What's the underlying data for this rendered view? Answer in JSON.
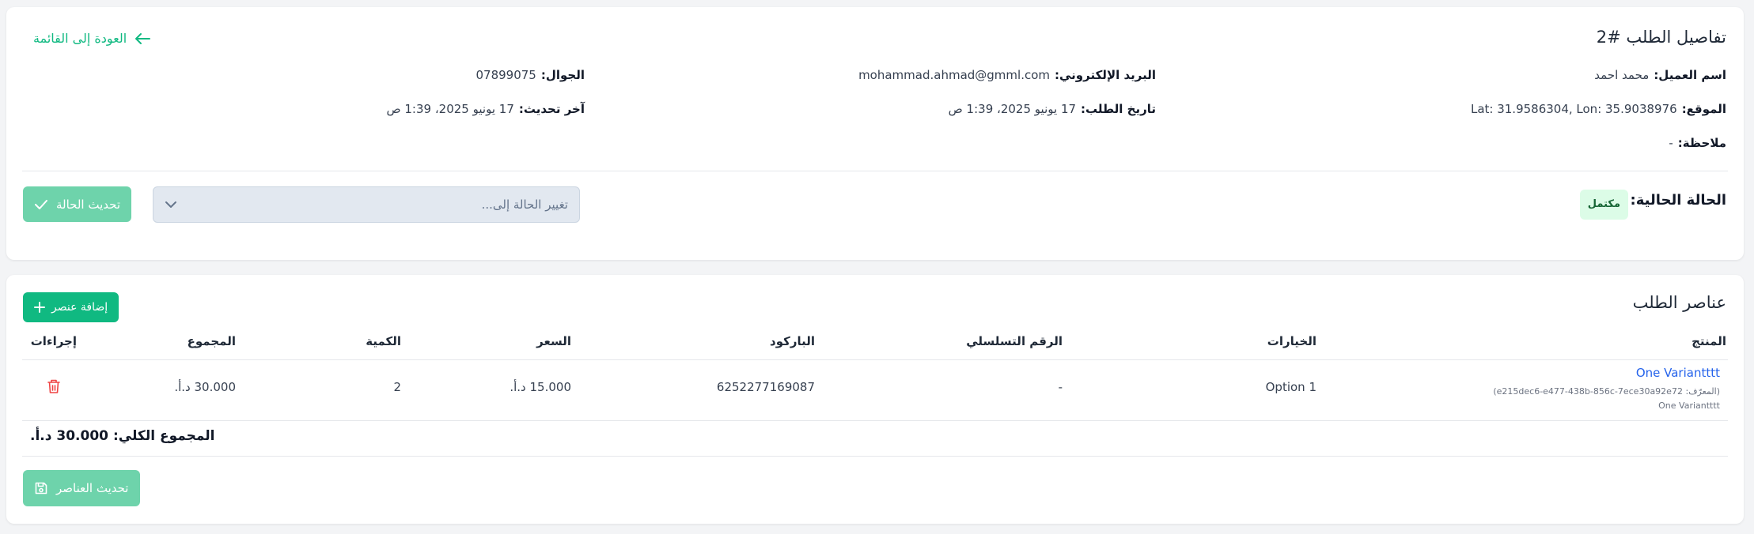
{
  "details": {
    "title": "تفاصيل الطلب #2",
    "back_label": "العودة إلى القائمة",
    "customer_name_label": "اسم العميل:",
    "customer_name": "محمد احمد",
    "email_label": "البريد الإلكتروني:",
    "email": "mohammad.ahmad@gmml.com",
    "phone_label": "الجوال:",
    "phone": "07899075",
    "location_label": "الموقع:",
    "location": "Lat: 31.9586304, Lon: 35.9038976",
    "order_date_label": "تاريخ الطلب:",
    "order_date": "17 يونيو 2025، 1:39 ص",
    "last_update_label": "آخر تحديث:",
    "last_update": "17 يونيو 2025، 1:39 ص",
    "note_label": "ملاحظة:",
    "note": "-",
    "current_status_label": "الحالة الحالية:",
    "current_status": "مكتمل",
    "status_select_placeholder": "تغيير الحالة إلى...",
    "update_status_label": "تحديث الحالة"
  },
  "items": {
    "title": "عناصر الطلب",
    "add_item_label": "إضافة عنصر",
    "columns": {
      "product": "المنتج",
      "options": "الخيارات",
      "serial": "الرقم التسلسلي",
      "barcode": "الباركود",
      "price": "السعر",
      "quantity": "الكمية",
      "total": "المجموع",
      "actions": "إجراءات"
    },
    "rows": [
      {
        "product_name": "One Variantttt",
        "product_id": "(المعرّف: e215dec6-e477-438b-856c-7ece30a92e72)",
        "product_subtitle": "One Variantttt",
        "options": "Option 1",
        "serial": "-",
        "barcode": "6252277169087",
        "price": "15.000 د.أ.",
        "quantity": "2",
        "total": "30.000 د.أ."
      }
    ],
    "grand_total_label": "المجموع الكلي:",
    "grand_total": "30.000 د.أ.",
    "update_items_label": "تحديث العناصر"
  },
  "colors": {
    "accent": "#10b981",
    "accent_light": "#6ed3ab",
    "link": "#2563eb",
    "danger": "#ef4444",
    "badge_bg": "#dcfce7",
    "badge_text": "#166534"
  },
  "icons": {
    "back": "arrow-left-icon",
    "check": "check-icon",
    "chevron": "chevron-down-icon",
    "plus": "plus-icon",
    "trash": "trash-icon",
    "save": "save-icon"
  }
}
